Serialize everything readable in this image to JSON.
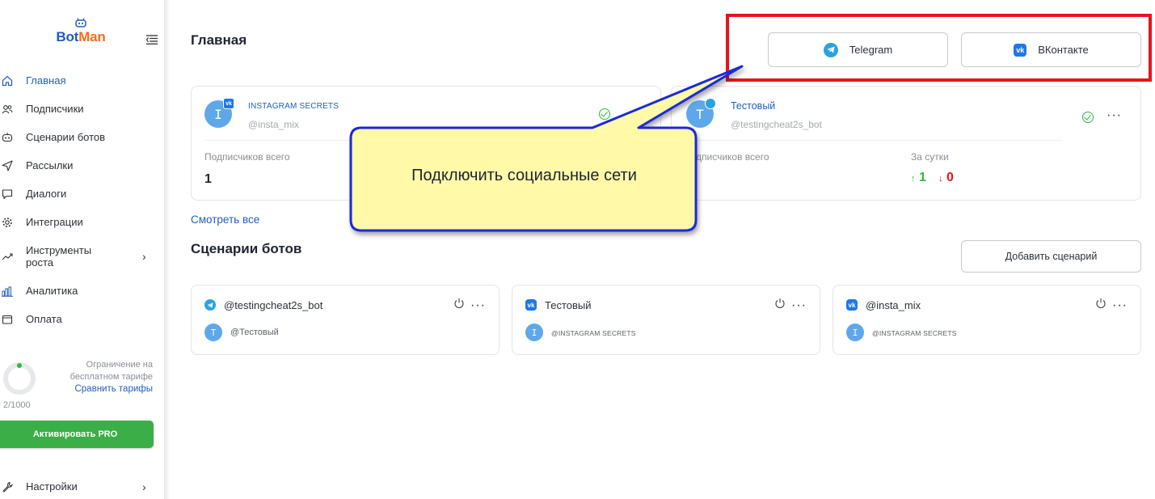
{
  "app": {
    "logo_bot": "Bot",
    "logo_man": "Man"
  },
  "sidebar": {
    "items": [
      {
        "label": "Главная",
        "icon": "home-icon",
        "active": true
      },
      {
        "label": "Подписчики",
        "icon": "users-icon"
      },
      {
        "label": "Сценарии ботов",
        "icon": "bot-icon"
      },
      {
        "label": "Рассылки",
        "icon": "send-icon"
      },
      {
        "label": "Диалоги",
        "icon": "chat-icon"
      },
      {
        "label": "Интеграции",
        "icon": "gear-icon"
      },
      {
        "label": "Инструменты роста",
        "icon": "growth-icon",
        "has_submenu": true
      },
      {
        "label": "Аналитика",
        "icon": "chart-icon"
      },
      {
        "label": "Оплата",
        "icon": "wallet-icon"
      }
    ],
    "settings_label": "Настройки",
    "limit": {
      "text_line1": "Ограничение на",
      "text_line2": "бесплатном тарифе",
      "compare_link": "Сравнить тарифы",
      "count": "2/1000",
      "used_fraction": 0.002
    },
    "pro_button": "Активировать PRO"
  },
  "main": {
    "title": "Главная",
    "connect": {
      "telegram": "Telegram",
      "vk": "ВКонтакте"
    },
    "bots": [
      {
        "name": "INSTAGRAM SECRETS",
        "handle": "@insta_mix",
        "avatar_letter": "I",
        "network": "vk",
        "subs_label": "Подписчиков всего",
        "subs_value": "1"
      },
      {
        "name": "Тестовый",
        "handle": "@testingcheat2s_bot",
        "avatar_letter": "T",
        "network": "telegram",
        "subs_label": "дписчиков всего",
        "day_label": "За сутки",
        "day_up": "1",
        "day_down": "0"
      }
    ],
    "see_all": "Смотреть все",
    "scenarios_title": "Сценарии ботов",
    "add_scenario": "Добавить сценарий",
    "scenarios": [
      {
        "title": "@testingcheat2s_bot",
        "network": "telegram",
        "avatar": "T",
        "sub": "@Тестовый"
      },
      {
        "title": "Тестовый",
        "network": "vk",
        "avatar": "I",
        "sub": "@INSTAGRAM SECRETS"
      },
      {
        "title": "@insta_mix",
        "network": "vk",
        "avatar": "I",
        "sub": "@INSTAGRAM SECRETS"
      }
    ]
  },
  "callout": {
    "text": "Подключить социальные сети"
  },
  "colors": {
    "accent": "#1f5fbf",
    "brand_orange": "#ff6a1a",
    "success": "#2db84a",
    "danger": "#e8141c",
    "pro_green": "#3cae48",
    "callout_fill": "#fff9a8",
    "callout_border": "#1a2bd6"
  }
}
